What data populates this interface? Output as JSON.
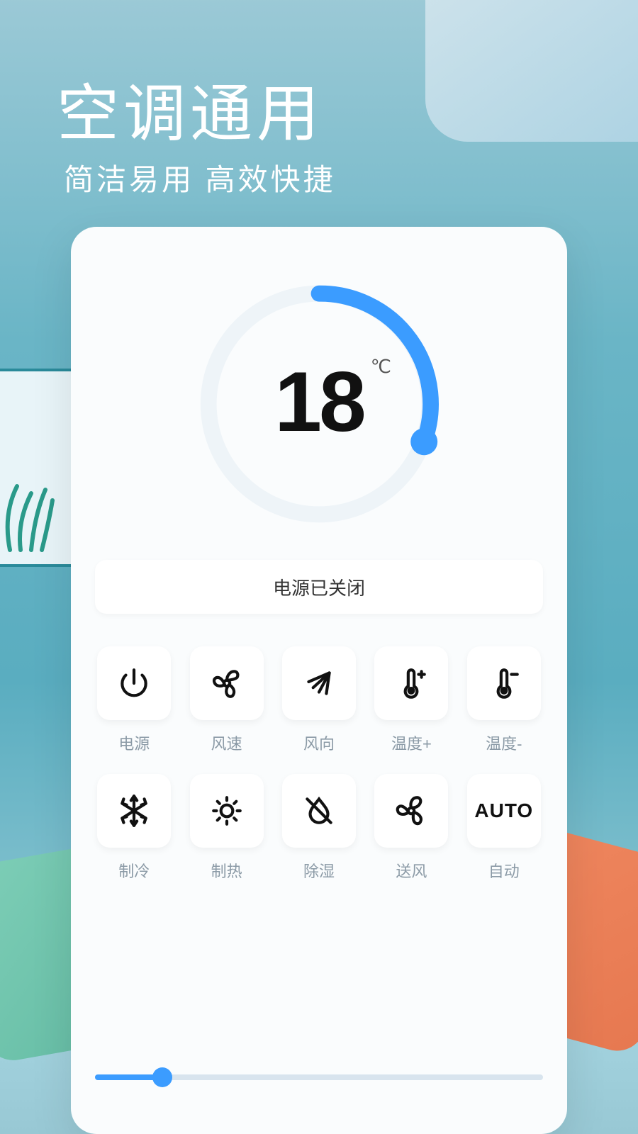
{
  "header": {
    "title": "空调通用",
    "subtitle": "简洁易用  高效快捷"
  },
  "dial": {
    "temperature": "18",
    "unit": "℃",
    "progress_percent": 30
  },
  "status": {
    "text": "电源已关闭"
  },
  "buttons": [
    {
      "id": "power",
      "label": "电源",
      "icon": "power-icon"
    },
    {
      "id": "fan-speed",
      "label": "风速",
      "icon": "fan-icon"
    },
    {
      "id": "swing",
      "label": "风向",
      "icon": "swing-icon"
    },
    {
      "id": "temp-up",
      "label": "温度+",
      "icon": "thermometer-plus-icon"
    },
    {
      "id": "temp-down",
      "label": "温度-",
      "icon": "thermometer-minus-icon"
    },
    {
      "id": "cool",
      "label": "制冷",
      "icon": "snowflake-icon"
    },
    {
      "id": "heat",
      "label": "制热",
      "icon": "sun-icon"
    },
    {
      "id": "dry",
      "label": "除湿",
      "icon": "droplet-off-icon"
    },
    {
      "id": "fan-mode",
      "label": "送风",
      "icon": "blower-icon"
    },
    {
      "id": "auto",
      "label": "自动",
      "icon": "auto-text",
      "text": "AUTO"
    }
  ],
  "slider": {
    "value_percent": 15
  },
  "colors": {
    "accent": "#3b9cff",
    "card_bg": "#fafcfd",
    "label": "#8b9aa6"
  }
}
